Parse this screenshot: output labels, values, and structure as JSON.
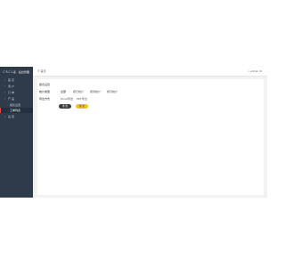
{
  "sidebar": {
    "title": "ＣＳＣＬ系 · 后台管理",
    "items": [
      {
        "icon": "◦",
        "label": "首 页"
      },
      {
        "icon": "◦",
        "label": "用 户"
      },
      {
        "icon": "◦",
        "label": "订 单"
      },
      {
        "icon": "◦",
        "label": "产 品"
      },
      {
        "icon": "·",
        "label": "报表设置"
      },
      {
        "icon": "·",
        "label": "工单列表"
      },
      {
        "icon": "◦",
        "label": "设 置"
      }
    ]
  },
  "topbar": {
    "left_icon": "menu-icon",
    "left_label": "首页",
    "right_icon": "fullscreen-icon",
    "right_label": "admin"
  },
  "main": {
    "title": "报表设置",
    "row1_label": "统计类型",
    "row1_tabs": [
      "全部",
      "按日统计",
      "按周统计",
      "按月统计"
    ],
    "row2_label": "导出方式",
    "row2_tabs": [
      "Excel导出",
      "PDF导出"
    ],
    "buttons": {
      "reset": "重 置",
      "submit": "提 交"
    }
  }
}
